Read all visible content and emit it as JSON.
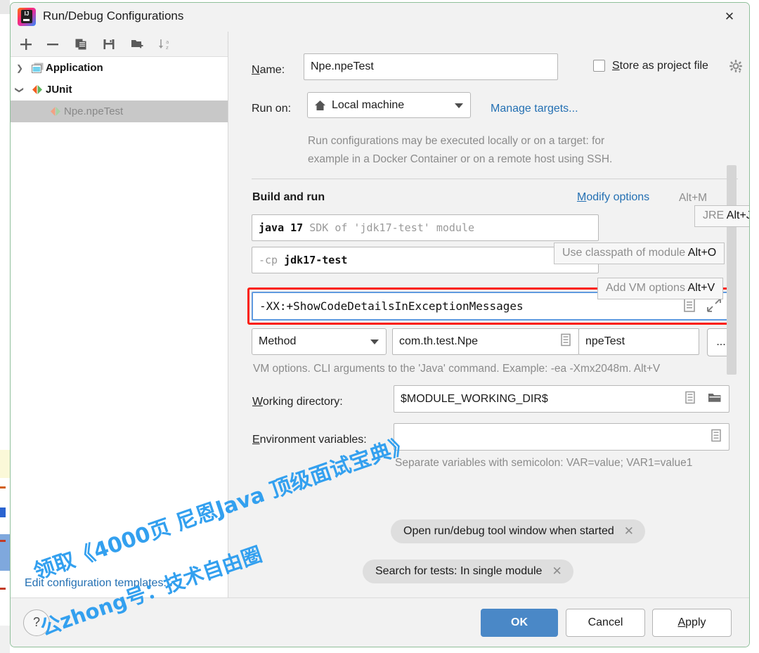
{
  "window": {
    "title": "Run/Debug Configurations",
    "logo_icon": "intellij-idea-logo",
    "close_icon": "close-icon"
  },
  "toolbar": {
    "buttons": [
      {
        "name": "add-configuration",
        "icon": "plus-icon"
      },
      {
        "name": "remove-configuration",
        "icon": "minus-icon"
      },
      {
        "name": "copy-configuration",
        "icon": "copy-icon"
      },
      {
        "name": "save-configuration",
        "icon": "save-icon"
      },
      {
        "name": "new-folder",
        "icon": "folder-add-icon"
      },
      {
        "name": "sort-configurations",
        "icon": "sort-az-icon"
      }
    ]
  },
  "tree": {
    "items": [
      {
        "label": "Application",
        "icon": "application-icon",
        "arrow": "chevron-right-icon",
        "selected": false,
        "child": false
      },
      {
        "label": "JUnit",
        "icon": "junit-icon",
        "arrow": "chevron-down-icon",
        "selected": false,
        "child": false
      },
      {
        "label": "Npe.npeTest",
        "icon": "junit-icon",
        "arrow": "",
        "selected": true,
        "child": true
      }
    ],
    "edit_templates_link": "Edit configuration templates..."
  },
  "form": {
    "name_label": "Name:",
    "name_accel": "N",
    "name_value": "Npe.npeTest",
    "store_as_project_file": "Store as project file",
    "store_accel": "S",
    "store_checked": false,
    "store_gear_icon": "gear-icon",
    "run_on_label": "Run on:",
    "run_on_value": "Local machine",
    "run_on_icon": "home-icon",
    "manage_targets_link": "Manage targets...",
    "description_line1": "Run configurations may be executed locally or on a target: for",
    "description_line2": "example in a Docker Container or on a remote host using SSH.",
    "build_and_run_header": "Build and run",
    "modify_options_link": "Modify options",
    "modify_options_accel": "M",
    "modify_options_shortcut": "Alt+M",
    "jre_field_prefix": "java 17",
    "jre_field_suffix": "SDK of 'jdk17-test' module",
    "classpath_field_prefix": "-cp",
    "classpath_field_value": "jdk17-test",
    "vm_options_value": "-XX:+ShowCodeDetailsInExceptionMessages",
    "vm_options_expand_icon": "expand-icon",
    "vm_options_list_icon": "list-icon",
    "kind_value": "Method",
    "class_value": "com.th.test.Npe",
    "method_value": "npeTest",
    "browse_button_label": "...",
    "vm_options_hint": "VM options. CLI arguments to the 'Java' command. Example: -ea -Xmx2048m. Alt+V",
    "working_directory_label": "Working directory:",
    "working_directory_accel": "W",
    "working_directory_value": "$MODULE_WORKING_DIR$",
    "working_directory_folder_icon": "folder-icon",
    "environment_variables_label": "Environment variables:",
    "environment_variables_accel": "E",
    "environment_variables_value": "",
    "environment_variables_hint": "Separate variables with semicolon: VAR=value; VAR1=value1",
    "chips": [
      {
        "label": "Open run/debug tool window when started",
        "close_icon": "close-icon"
      },
      {
        "label": "Search for tests: In single module",
        "close_icon": "close-icon"
      }
    ]
  },
  "tooltips": [
    {
      "text": "JRE ",
      "shortcut": "Alt+J"
    },
    {
      "text": "Use classpath of module ",
      "shortcut": "Alt+O"
    },
    {
      "text": "Add VM options ",
      "shortcut": "Alt+V"
    }
  ],
  "footer": {
    "help_label": "?",
    "ok_label": "OK",
    "cancel_label": "Cancel",
    "apply_label": "Apply",
    "apply_accel": "A"
  },
  "watermark": {
    "line1": "领取《4000页 尼恩Java 顶级面试宝典》",
    "line2": "公zhong号：技术自由圈"
  },
  "colors": {
    "accent_blue": "#2470b3",
    "primary_button": "#4a88c7",
    "annotation_red": "#fb1e0e",
    "focus_border": "#5f9be0",
    "watermark_blue": "#33a0ef"
  }
}
